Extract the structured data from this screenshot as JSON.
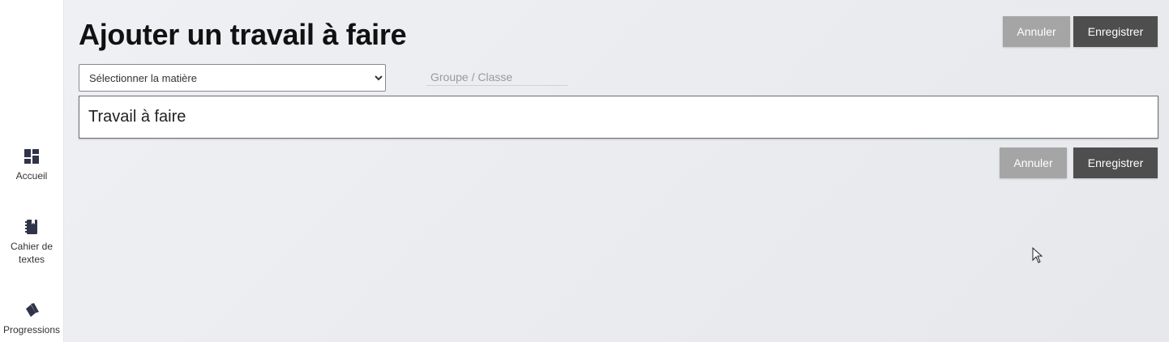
{
  "sidebar": {
    "items": [
      {
        "label": "Accueil",
        "icon": "dashboard-icon"
      },
      {
        "label": "Cahier de textes",
        "icon": "notebook-icon"
      },
      {
        "label": "Progressions",
        "icon": "cards-icon"
      }
    ]
  },
  "header": {
    "title": "Ajouter un travail à faire",
    "cancel_label": "Annuler",
    "save_label": "Enregistrer"
  },
  "form": {
    "subject_select": {
      "value": "Sélectionner la matière",
      "options": [
        "Sélectionner la matière"
      ]
    },
    "group_input": {
      "placeholder": "Groupe / Classe",
      "value": ""
    },
    "work_field": {
      "placeholder": "Travail à faire",
      "value": ""
    }
  },
  "footer_actions": {
    "cancel_label": "Annuler",
    "save_label": "Enregistrer"
  },
  "colors": {
    "cancel_button": "#a5a5a5",
    "save_button": "#4e4e4e",
    "background": "#eceef2",
    "sidebar": "#ffffff"
  }
}
